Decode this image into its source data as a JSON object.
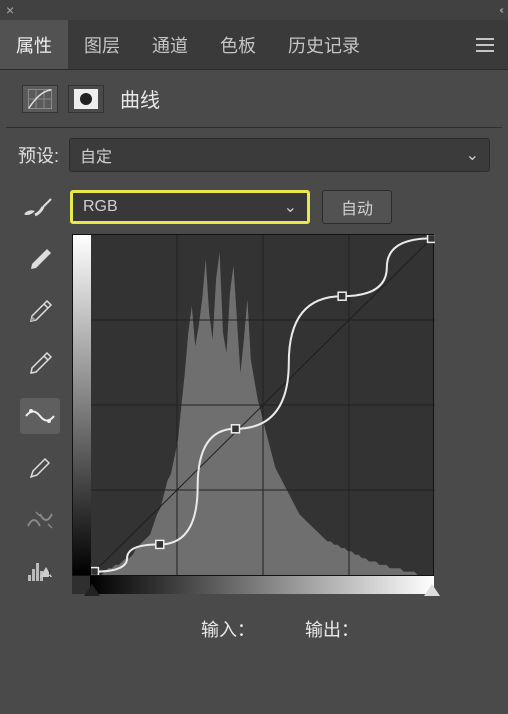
{
  "tabs": {
    "t0": "属性",
    "t1": "图层",
    "t2": "通道",
    "t3": "色板",
    "t4": "历史记录"
  },
  "panel": {
    "title": "曲线"
  },
  "preset": {
    "label": "预设:",
    "value": "自定"
  },
  "channel": {
    "value": "RGB"
  },
  "auto": {
    "label": "自动"
  },
  "io": {
    "input": "输入：",
    "output": "输出："
  },
  "curve": {
    "points": [
      {
        "x": 0.01,
        "y": 0.01
      },
      {
        "x": 0.2,
        "y": 0.09
      },
      {
        "x": 0.42,
        "y": 0.43
      },
      {
        "x": 0.73,
        "y": 0.82
      },
      {
        "x": 0.99,
        "y": 0.99
      }
    ],
    "histogram": [
      0,
      0,
      0,
      0,
      1,
      2,
      2,
      3,
      3,
      4,
      5,
      5,
      6,
      8,
      9,
      10,
      11,
      12,
      15,
      18,
      20,
      24,
      28,
      30,
      35,
      40,
      50,
      60,
      72,
      80,
      68,
      74,
      82,
      94,
      78,
      70,
      88,
      96,
      72,
      66,
      84,
      92,
      76,
      60,
      70,
      82,
      64,
      58,
      52,
      48,
      44,
      40,
      36,
      32,
      30,
      28,
      26,
      24,
      22,
      20,
      18,
      17,
      16,
      15,
      14,
      13,
      12,
      11,
      10,
      10,
      9,
      9,
      8,
      8,
      7,
      7,
      6,
      6,
      5,
      5,
      4,
      4,
      4,
      3,
      3,
      3,
      2,
      2,
      2,
      2,
      1,
      1,
      1,
      1,
      0,
      0,
      0,
      0,
      0,
      0
    ]
  }
}
